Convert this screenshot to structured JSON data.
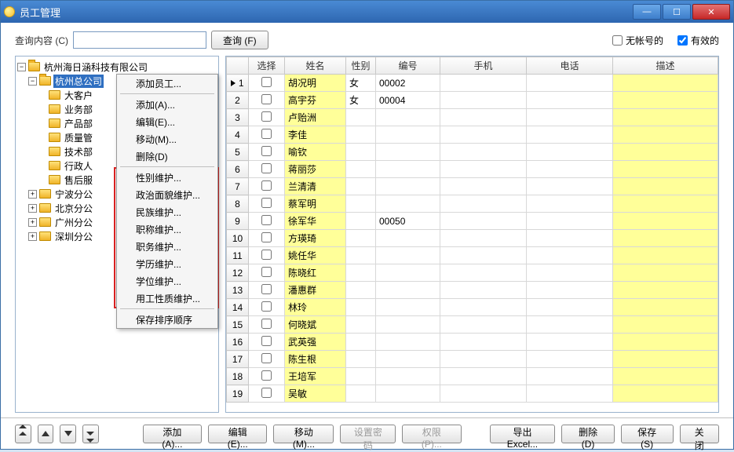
{
  "window": {
    "title": "员工管理"
  },
  "search": {
    "label": "查询内容 (C)",
    "btn": "查询 (F)"
  },
  "options": {
    "no_account": {
      "label": "无帐号的",
      "checked": false
    },
    "valid": {
      "label": "有效的",
      "checked": true
    }
  },
  "tree": {
    "root": "杭州海日涵科技有限公司",
    "selected": "杭州总公司",
    "children": [
      "大客户",
      "业务部",
      "产品部",
      "质量管",
      "技术部",
      "行政人",
      "售后服"
    ],
    "siblings": [
      "宁波分公",
      "北京分公",
      "广州分公",
      "深圳分公"
    ]
  },
  "context_menu": {
    "g1": [
      "添加员工..."
    ],
    "g2": [
      "添加(A)...",
      "编辑(E)...",
      "移动(M)...",
      "删除(D)"
    ],
    "g3": [
      "性别维护...",
      "政治面貌维护...",
      "民族维护...",
      "职称维护...",
      "职务维护...",
      "学历维护...",
      "学位维护...",
      "用工性质维护..."
    ],
    "g4": [
      "保存排序顺序"
    ]
  },
  "table": {
    "headers": {
      "sel": "选择",
      "name": "姓名",
      "gender": "性别",
      "id": "编号",
      "mobile": "手机",
      "phone": "电话",
      "desc": "描述"
    },
    "rows": [
      {
        "n": 1,
        "name": "胡况明",
        "gender": "女",
        "id": "00002"
      },
      {
        "n": 2,
        "name": "高宇芬",
        "gender": "女",
        "id": "00004"
      },
      {
        "n": 3,
        "name": "卢贻洲"
      },
      {
        "n": 4,
        "name": "李佳"
      },
      {
        "n": 5,
        "name": "喻钦"
      },
      {
        "n": 6,
        "name": "蒋丽莎"
      },
      {
        "n": 7,
        "name": "兰清清"
      },
      {
        "n": 8,
        "name": "蔡军明"
      },
      {
        "n": 9,
        "name": "徐军华",
        "id": "00050"
      },
      {
        "n": 10,
        "name": "方瑛琦"
      },
      {
        "n": 11,
        "name": "姚任华"
      },
      {
        "n": 12,
        "name": "陈晓红"
      },
      {
        "n": 13,
        "name": "潘惠群"
      },
      {
        "n": 14,
        "name": "林玲"
      },
      {
        "n": 15,
        "name": "何晓斌"
      },
      {
        "n": 16,
        "name": "武英强"
      },
      {
        "n": 17,
        "name": "陈生根"
      },
      {
        "n": 18,
        "name": "王培军"
      },
      {
        "n": 19,
        "name": "吴敏"
      }
    ]
  },
  "bottom": {
    "add": "添加 (A)...",
    "edit": "编辑 (E)...",
    "move": "移动 (M)...",
    "setpw": "设置密码",
    "perm": "权限 (P)...",
    "export": "导出Excel...",
    "delete": "删除 (D)",
    "save": "保存 (S)",
    "close": "关闭"
  }
}
